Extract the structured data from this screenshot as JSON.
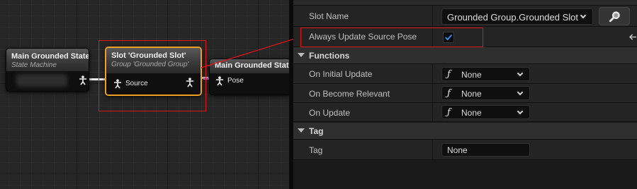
{
  "graph": {
    "nodes": {
      "main_state": {
        "title": "Main Grounded State",
        "subtitle": "State Machine"
      },
      "slot": {
        "title": "Slot 'Grounded Slot'",
        "subtitle": "Group 'Grounded Group'",
        "input_pin": "Source"
      },
      "output": {
        "title": "Main Grounded State",
        "input_pin": "Pose"
      }
    },
    "colors": {
      "highlight_border": "#e01515",
      "selected_node": "#f0a020",
      "wire": "#ececec",
      "pose_wire": "#b060c0"
    }
  },
  "details": {
    "slot_name": {
      "label": "Slot Name",
      "value": "Grounded Group.Grounded Slot"
    },
    "always_update": {
      "label": "Always Update Source Pose",
      "checked": true
    },
    "functions": {
      "title": "Functions",
      "rows": [
        {
          "label": "On Initial Update",
          "value": "None"
        },
        {
          "label": "On Become Relevant",
          "value": "None"
        },
        {
          "label": "On Update",
          "value": "None"
        }
      ]
    },
    "tag": {
      "title": "Tag",
      "label": "Tag",
      "value": "None"
    },
    "icons": {
      "browse": "search-icon",
      "reset": "reset-arrow-icon",
      "function": "function-icon"
    },
    "colors": {
      "checkbox_check": "#2f8fe8",
      "accent": "#2f8fe8"
    }
  }
}
